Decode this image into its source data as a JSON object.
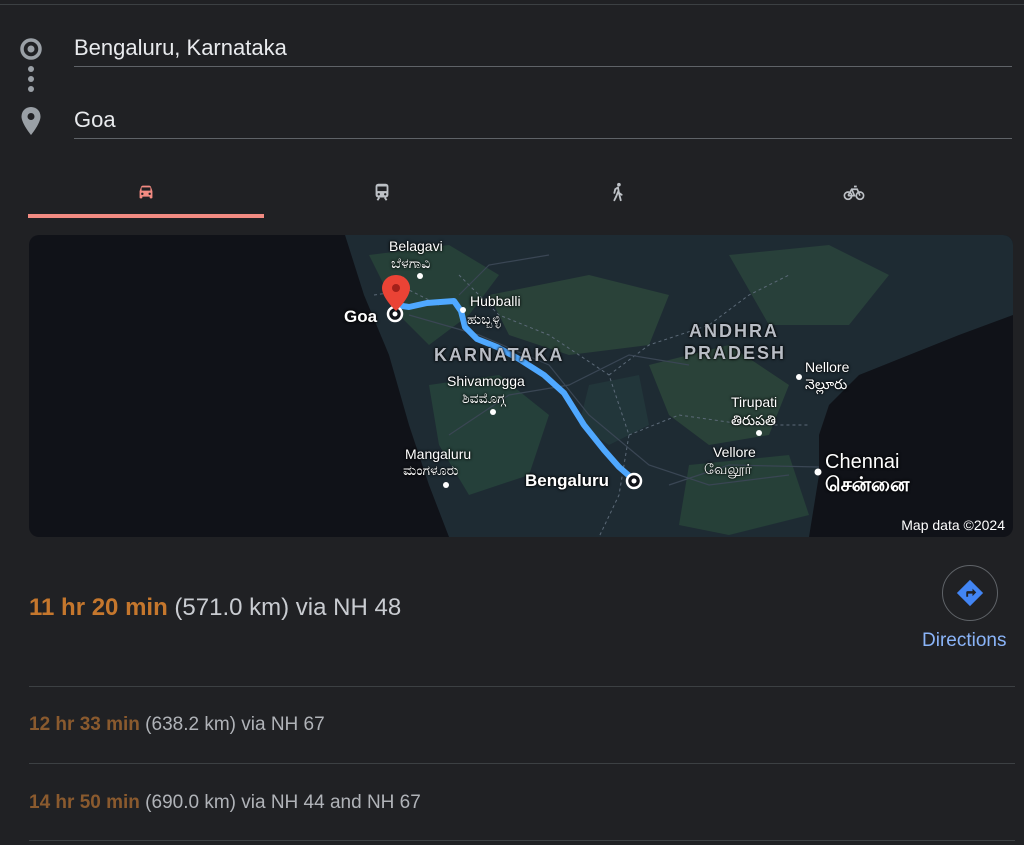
{
  "waypoints": {
    "origin": "Bengaluru, Karnataka",
    "destination": "Goa"
  },
  "transport_modes": [
    {
      "icon": "car-icon",
      "selected": true
    },
    {
      "icon": "transit-icon",
      "selected": false
    },
    {
      "icon": "walking-icon",
      "selected": false
    },
    {
      "icon": "cycling-icon",
      "selected": false
    }
  ],
  "map": {
    "labels": {
      "belagavi": "Belagavi",
      "belagavi_kn": "ಬೆಳಗಾವಿ",
      "goa": "Goa",
      "hubballi": "Hubballi",
      "hubballi_kn": "ಹುಬ್ಬಳ್ಳಿ",
      "karnataka": "KARNATAKA",
      "andhra": "ANDHRA",
      "pradesh": "PRADESH",
      "nellore": "Nellore",
      "nellore_te": "నెల్లూరు",
      "shivamogga": "Shivamogga",
      "shivamogga_kn": "ಶಿವಮೊಗ್ಗ",
      "tirupati": "Tirupati",
      "tirupati_te": "తిరుపతి",
      "mangaluru": "Mangaluru",
      "mangaluru_kn": "ಮಂಗಳೂರು",
      "vellore": "Vellore",
      "vellore_ta": "வேலூர்",
      "chennai": "Chennai",
      "chennai_ta": "சென்னை",
      "bengaluru": "Bengaluru"
    },
    "credit": "Map data ©2024",
    "route_color": "#4fa8ff",
    "pin_color": "#ea4335"
  },
  "routes": {
    "primary": {
      "duration": "11 hr 20 min",
      "detail": "(571.0 km) via NH 48"
    },
    "alternatives": [
      {
        "duration": "12 hr 33 min",
        "detail": "(638.2 km) via NH 67"
      },
      {
        "duration": "14 hr 50 min",
        "detail": "(690.0 km) via NH 44 and NH 67"
      }
    ]
  },
  "directions": {
    "label": "Directions",
    "icon": "directions-arrow-icon"
  },
  "colors": {
    "accent_tab": "#f28b82",
    "duration": "#c5772d",
    "link": "#8ab4f8",
    "background": "#202124"
  }
}
